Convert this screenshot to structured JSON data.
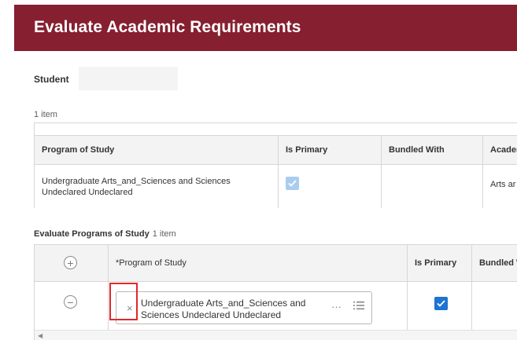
{
  "header": {
    "title": "Evaluate Academic Requirements",
    "bg_color": "#861f30"
  },
  "student": {
    "label": "Student",
    "value": ""
  },
  "academic_table": {
    "item_count": "1 item",
    "columns": [
      "Program of Study",
      "Is Primary",
      "Bundled With",
      "Acader"
    ],
    "rows": [
      {
        "program": "Undergraduate Arts_and_Sciences and Sciences Undeclared Undeclared",
        "is_primary": true,
        "bundled_with": "",
        "academic": "Arts ar"
      }
    ]
  },
  "evaluate_section": {
    "title": "Evaluate Programs of Study",
    "item_count": "1 item",
    "columns": [
      "*Program of Study",
      "Is Primary",
      "Bundled With"
    ],
    "add_icon": "plus-circle-icon",
    "rows": [
      {
        "program": "Undergraduate Arts_and_Sciences and Sciences Undeclared Undeclared",
        "is_primary": true,
        "bundled_with": "",
        "remove_icon": "minus-circle-icon",
        "more_icon": "ellipsis-icon",
        "prompt_icon": "list-icon",
        "clear_icon": "close-icon"
      }
    ]
  },
  "colors": {
    "checkbox_checked": "#1f73d1",
    "checkbox_disabled": "#a9cdef",
    "highlight": "#e0282c"
  }
}
